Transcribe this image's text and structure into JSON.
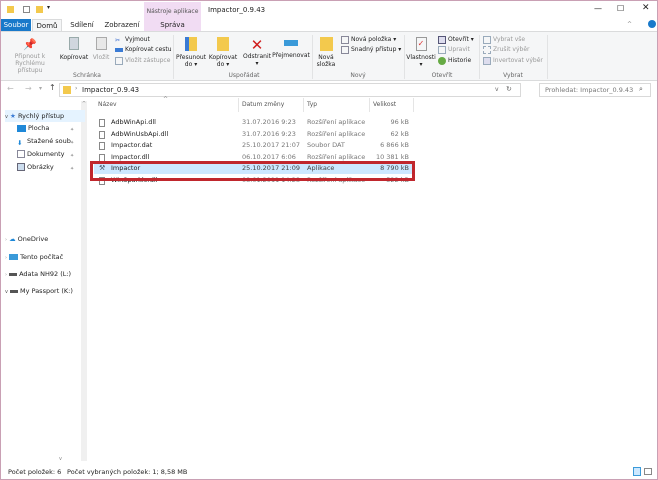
{
  "window": {
    "title": "Impactor_0.9.43",
    "context_tab_group": "Nástroje aplikace",
    "controls": [
      "minimize",
      "maximize",
      "close"
    ]
  },
  "tabs": [
    {
      "label": "Soubor",
      "active": false,
      "file": true
    },
    {
      "label": "Domů",
      "active": true
    },
    {
      "label": "Sdílení"
    },
    {
      "label": "Zobrazení"
    },
    {
      "label": "Správa"
    }
  ],
  "ribbon": {
    "schranka": {
      "label": "Schránka",
      "pin": "Připnout k Rychlému přístupu",
      "copy": "Kopírovat",
      "paste": "Vložit",
      "cut": "Vyjmout",
      "copy_path": "Kopírovat cestu",
      "paste_shortcut": "Vložit zástupce"
    },
    "usporadat": {
      "label": "Uspořádat",
      "move": "Přesunout do",
      "copy_to": "Kopírovat do",
      "delete": "Odstranit",
      "rename": "Přejmenovat"
    },
    "novy": {
      "label": "Nový",
      "new_folder": "Nová složka",
      "new_item": "Nová položka",
      "easy_access": "Snadný přístup"
    },
    "otevrit": {
      "label": "Otevřít",
      "properties": "Vlastnosti",
      "open": "Otevřít",
      "edit": "Upravit",
      "history": "Historie"
    },
    "vybrat": {
      "label": "Vybrat",
      "select_all": "Vybrat vše",
      "select_none": "Zrušit výběr",
      "invert": "Invertovat výběr"
    }
  },
  "address": {
    "path": "Impactor_0.9.43",
    "search_placeholder": "Prohledat: Impactor_0.9.43"
  },
  "nav": {
    "quick_access": "Rychlý přístup",
    "items": [
      "Plocha",
      "Stažené soub",
      "Dokumenty",
      "Obrázky"
    ],
    "onedrive": "OneDrive",
    "this_pc": "Tento počítač",
    "drives": [
      "Adata NH92 (L:)",
      "My Passport (K:)"
    ]
  },
  "columns": {
    "name": "Název",
    "date": "Datum změny",
    "type": "Typ",
    "size": "Velikost"
  },
  "files": [
    {
      "name": "AdbWinApi.dll",
      "date": "31.07.2016 9:23",
      "type": "Rozšíření aplikace",
      "size": "96 kB"
    },
    {
      "name": "AdbWinUsbApi.dll",
      "date": "31.07.2016 9:23",
      "type": "Rozšíření aplikace",
      "size": "62 kB"
    },
    {
      "name": "Impactor.dat",
      "date": "25.10.2017 21:07",
      "type": "Soubor DAT",
      "size": "6 866 kB"
    },
    {
      "name": "Impactor.dll",
      "date": "06.10.2017 6:06",
      "type": "Rozšíření aplikace",
      "size": "10 381 kB"
    },
    {
      "name": "Impactor",
      "date": "25.10.2017 21:09",
      "type": "Aplikace",
      "size": "8 790 kB",
      "selected": true
    },
    {
      "name": "WinSparkle.dll",
      "date": "08.01.2011 14:28",
      "type": "Rozšíření aplikace",
      "size": "522 kB"
    }
  ],
  "status": {
    "count": "Počet položek: 6",
    "selected": "Počet vybraných položek: 1; 8,58 MB"
  },
  "colors": {
    "file_tab": "#1979ca",
    "context_tab": "#f1dcf3",
    "selection": "#cce8ff",
    "highlight_box": "#c0272d"
  }
}
